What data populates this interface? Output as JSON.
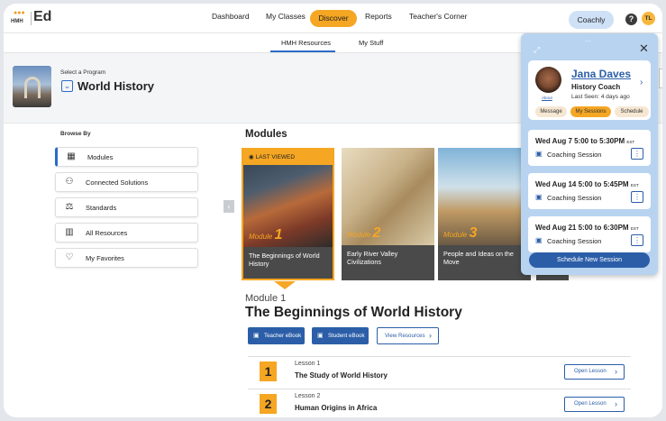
{
  "app": {
    "logo_text": "HMH",
    "logo_dots": "●●●",
    "title": "Ed"
  },
  "nav": {
    "dashboard": "Dashboard",
    "my_classes": "My Classes",
    "discover": "Discover",
    "reports": "Reports",
    "teachers_corner": "Teacher's Corner",
    "coachly": "Coachly",
    "help": "?",
    "avatar": "TL"
  },
  "subnav": {
    "hmh_resources": "HMH Resources",
    "my_stuff": "My Stuff"
  },
  "program": {
    "select_label": "Select a Program",
    "name": "World History"
  },
  "browse": {
    "label": "Browse By",
    "items": [
      {
        "label": "Modules",
        "icon": "grid-icon"
      },
      {
        "label": "Connected Solutions",
        "icon": "nodes-icon"
      },
      {
        "label": "Standards",
        "icon": "scales-icon"
      },
      {
        "label": "All Resources",
        "icon": "book-icon"
      },
      {
        "label": "My Favorites",
        "icon": "heart-icon"
      }
    ]
  },
  "modules": {
    "heading": "Modules",
    "last_viewed": "LAST VIEWED",
    "cards": [
      {
        "prefix": "Module",
        "number": "1",
        "title": "The Beginnings of World History"
      },
      {
        "prefix": "Module",
        "number": "2",
        "title": "Early River Valley Civilizations"
      },
      {
        "prefix": "Module",
        "number": "3",
        "title": "People and Ideas on the Move"
      }
    ]
  },
  "selected_module": {
    "subtitle": "Module 1",
    "title": "The Beginnings of World History",
    "teacher_ebook": "Teacher eBook",
    "student_ebook": "Student eBook",
    "view_resources": "View Resources"
  },
  "lessons": [
    {
      "number": "1",
      "label": "Lesson 1",
      "title": "The Study of World History",
      "button": "Open Lesson"
    },
    {
      "number": "2",
      "label": "Lesson 2",
      "title": "Human Origins in Africa",
      "button": "Open Lesson"
    }
  ],
  "coach": {
    "name": "Jana Daves",
    "role": "History Coach",
    "last_seen": "Last Seen: 4 days ago",
    "about": "About",
    "pill_message": "Message",
    "pill_sessions": "My Sessions",
    "pill_schedule": "Schedule",
    "sessions": [
      {
        "date": "Wed Aug 7 5:00 to 5:30PM",
        "tz": "EST",
        "type": "Coaching Session"
      },
      {
        "date": "Wed Aug 14 5:00 to 5:45PM",
        "tz": "EST",
        "type": "Coaching Session"
      },
      {
        "date": "Wed Aug 21 5:00 to 6:30PM",
        "tz": "EST",
        "type": "Coaching Session"
      }
    ],
    "schedule_button": "Schedule New Session"
  },
  "colors": {
    "accent": "#f5a623",
    "primary": "#2c5ea8",
    "coach_panel": "#b7d3f0"
  }
}
